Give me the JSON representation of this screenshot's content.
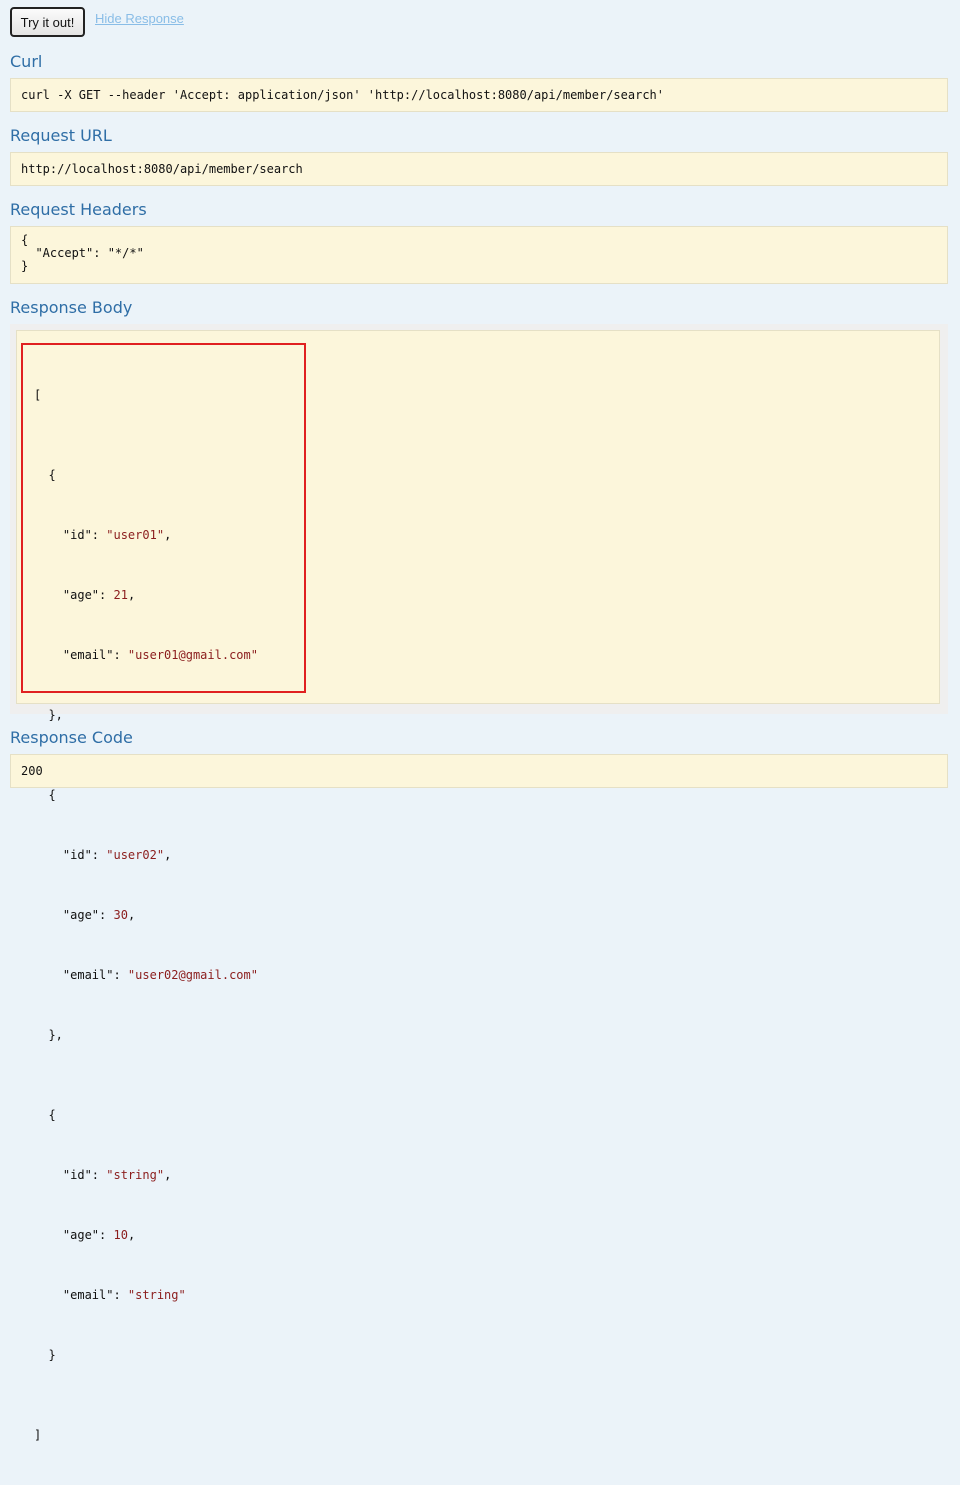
{
  "controls": {
    "try_button": "Try it out!",
    "hide_response": "Hide Response"
  },
  "curl": {
    "title": "Curl",
    "command": "curl -X GET --header 'Accept: application/json' 'http://localhost:8080/api/member/search'"
  },
  "request_url": {
    "title": "Request URL",
    "value": "http://localhost:8080/api/member/search"
  },
  "request_headers": {
    "title": "Request Headers",
    "open": "{",
    "line": "  \"Accept\": \"*/*\"",
    "close": "}"
  },
  "response_body": {
    "title": "Response Body",
    "members": [
      {
        "id": "user01",
        "age": "21",
        "email": "user01@gmail.com"
      },
      {
        "id": "user02",
        "age": "30",
        "email": "user02@gmail.com"
      },
      {
        "id": "string",
        "age": "10",
        "email": "string"
      }
    ]
  },
  "response_code": {
    "title": "Response Code",
    "value": "200"
  },
  "colors": {
    "background": "#ebf3f9",
    "title": "#2f6ea6",
    "code_bg": "#fcf6db",
    "json_value": "#8b1d1d",
    "highlight_border": "#e02020",
    "link": "#89bde7"
  }
}
